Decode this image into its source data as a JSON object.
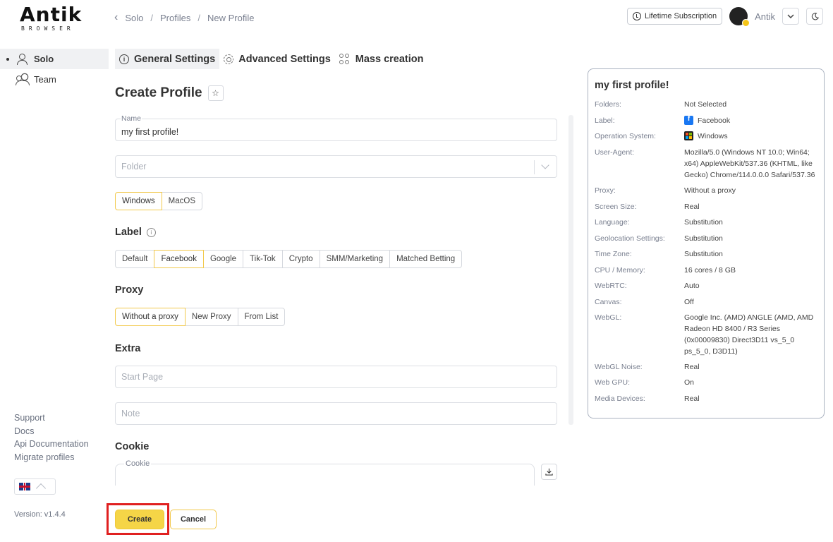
{
  "brand": {
    "logo_top": "Antik",
    "logo_bottom": "BROWSER"
  },
  "breadcrumb": {
    "items": [
      "Solo",
      "Profiles",
      "New Profile"
    ],
    "separator": "/"
  },
  "topbar": {
    "subscription_label": "Lifetime Subscription",
    "user_name": "Antik"
  },
  "sidebar": {
    "items": [
      {
        "label": "Solo",
        "active": true
      },
      {
        "label": "Team",
        "active": false
      }
    ],
    "links": [
      "Support",
      "Docs",
      "Api Documentation",
      "Migrate profiles"
    ],
    "version": "Version: v1.4.4"
  },
  "tabs": [
    {
      "label": "General Settings",
      "active": true
    },
    {
      "label": "Advanced Settings",
      "active": false
    },
    {
      "label": "Mass creation",
      "active": false
    }
  ],
  "form": {
    "title": "Create Profile",
    "name_label": "Name",
    "name_value": "my first profile!",
    "folder_placeholder": "Folder",
    "os_options": [
      "Windows",
      "MacOS"
    ],
    "os_selected": "Windows",
    "label_heading": "Label",
    "label_options": [
      "Default",
      "Facebook",
      "Google",
      "Tik-Tok",
      "Crypto",
      "SMM/Marketing",
      "Matched Betting"
    ],
    "label_selected": "Facebook",
    "proxy_heading": "Proxy",
    "proxy_options": [
      "Without a proxy",
      "New Proxy",
      "From List"
    ],
    "proxy_selected": "Without a proxy",
    "extra_heading": "Extra",
    "start_page_placeholder": "Start Page",
    "note_placeholder": "Note",
    "cookie_heading": "Cookie",
    "cookie_label": "Cookie"
  },
  "actions": {
    "create": "Create",
    "cancel": "Cancel"
  },
  "summary": {
    "title": "my first profile!",
    "rows": [
      {
        "key": "Folders:",
        "value": "Not Selected"
      },
      {
        "key": "Label:",
        "value": "Facebook",
        "icon": "facebook-icon"
      },
      {
        "key": "Operation System:",
        "value": "Windows",
        "icon": "windows-icon"
      },
      {
        "key": "User-Agent:",
        "value": "Mozilla/5.0 (Windows NT 10.0; Win64; x64) AppleWebKit/537.36 (KHTML, like Gecko) Chrome/114.0.0.0 Safari/537.36"
      },
      {
        "key": "Proxy:",
        "value": "Without a proxy"
      },
      {
        "key": "Screen Size:",
        "value": "Real"
      },
      {
        "key": "Language:",
        "value": "Substitution"
      },
      {
        "key": "Geolocation Settings:",
        "value": "Substitution"
      },
      {
        "key": "Time Zone:",
        "value": "Substitution"
      },
      {
        "key": "CPU / Memory:",
        "value": "16 cores / 8 GB"
      },
      {
        "key": "WebRTC:",
        "value": "Auto"
      },
      {
        "key": "Canvas:",
        "value": "Off"
      },
      {
        "key": "WebGL:",
        "value": "Google Inc. (AMD) ANGLE (AMD, AMD Radeon HD 8400 / R3 Series (0x00009830) Direct3D11 vs_5_0 ps_5_0, D3D11)"
      },
      {
        "key": "WebGL Noise:",
        "value": "Real"
      },
      {
        "key": "Web GPU:",
        "value": "On"
      },
      {
        "key": "Media Devices:",
        "value": "Real"
      }
    ]
  },
  "colors": {
    "accent": "#f5d547",
    "accent_border": "#f2c94c",
    "highlight": "#e02020",
    "facebook": "#1877f2"
  }
}
